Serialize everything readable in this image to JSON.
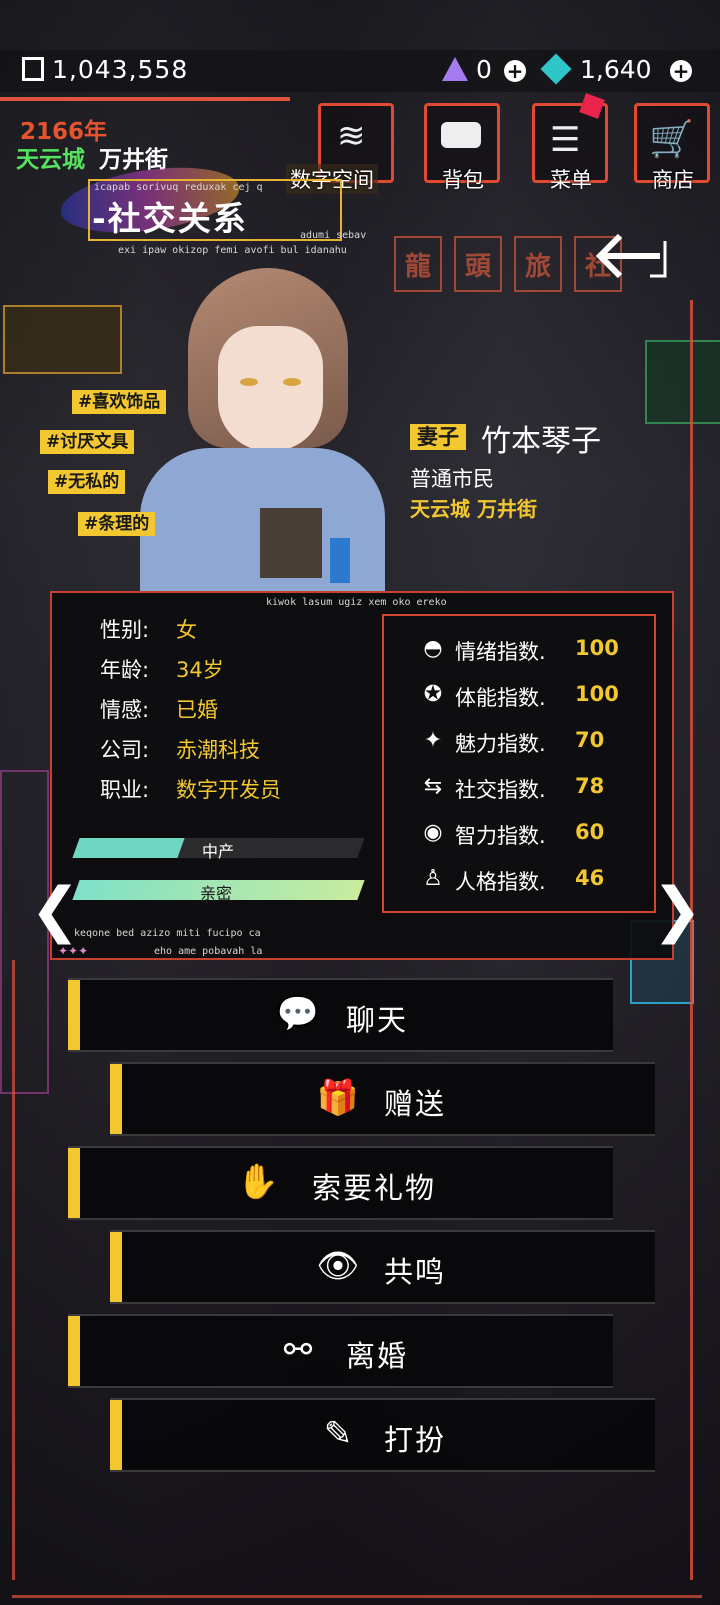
{
  "currency": {
    "amount": "1,043,558"
  },
  "resources": [
    {
      "name": "triangle-gem",
      "value": "0"
    },
    {
      "name": "diamond-gem",
      "value": "1,640"
    }
  ],
  "world": {
    "year": "2166年",
    "city": "天云城",
    "street": "万井街"
  },
  "menu": [
    {
      "label": "数字空间",
      "icon": "layers-icon"
    },
    {
      "label": "背包",
      "icon": "bag-icon"
    },
    {
      "label": "菜单",
      "icon": "list-icon"
    },
    {
      "label": "商店",
      "icon": "cart-icon"
    }
  ],
  "page": {
    "title": "社交关系",
    "caption_top": "icapab sorivuq reduxak cej q",
    "caption_right": "adumi sebav",
    "caption_bottom": "exi ipaw okizop femi avofi bul idanahu"
  },
  "traits": [
    "#喜欢饰品",
    "#讨厌文具",
    "#无私的",
    "#条理的"
  ],
  "character": {
    "relation": "妻子",
    "name": "竹本琴子",
    "role": "普通市民",
    "location": "天云城 万井街"
  },
  "panel_caption": "kiwok lasum ugiz xem oko ereko",
  "profile": [
    {
      "label": "性别:",
      "value": "女"
    },
    {
      "label": "年龄:",
      "value": "34岁"
    },
    {
      "label": "情感:",
      "value": "已婚"
    },
    {
      "label": "公司:",
      "value": "赤潮科技"
    },
    {
      "label": "职业:",
      "value": "数字开发员"
    }
  ],
  "bars": [
    {
      "label": "中产",
      "level": 0.35,
      "color": "#6fd6c2"
    },
    {
      "label": "亲密",
      "level": 1.0,
      "color": "#a7e3a0"
    }
  ],
  "stats": [
    {
      "label": "情绪指数.",
      "value": "100",
      "icon": "face-icon"
    },
    {
      "label": "体能指数.",
      "value": "100",
      "icon": "muscle-icon"
    },
    {
      "label": "魅力指数.",
      "value": "70",
      "icon": "sparkle-icon"
    },
    {
      "label": "社交指数.",
      "value": "78",
      "icon": "social-icon"
    },
    {
      "label": "智力指数.",
      "value": "60",
      "icon": "eye-icon"
    },
    {
      "label": "人格指数.",
      "value": "46",
      "icon": "person-icon"
    }
  ],
  "panel_footer": {
    "line1": "keqone bed azizo miti fucipo ca",
    "line2": "eho ame pobavah la"
  },
  "actions": [
    {
      "label": "聊天",
      "icon": "chat-icon"
    },
    {
      "label": "赠送",
      "icon": "gift-icon"
    },
    {
      "label": "索要礼物",
      "icon": "hand-gift-icon"
    },
    {
      "label": "共鸣",
      "icon": "resonance-eye-icon"
    },
    {
      "label": "离婚",
      "icon": "broken-ring-icon"
    },
    {
      "label": "打扮",
      "icon": "dress-up-icon"
    }
  ],
  "background_signs": [
    "龍",
    "頭",
    "旅",
    "社"
  ],
  "colors": {
    "accent": "#e0533c",
    "gold": "#f3c730",
    "panel": "#0c0c0e"
  }
}
